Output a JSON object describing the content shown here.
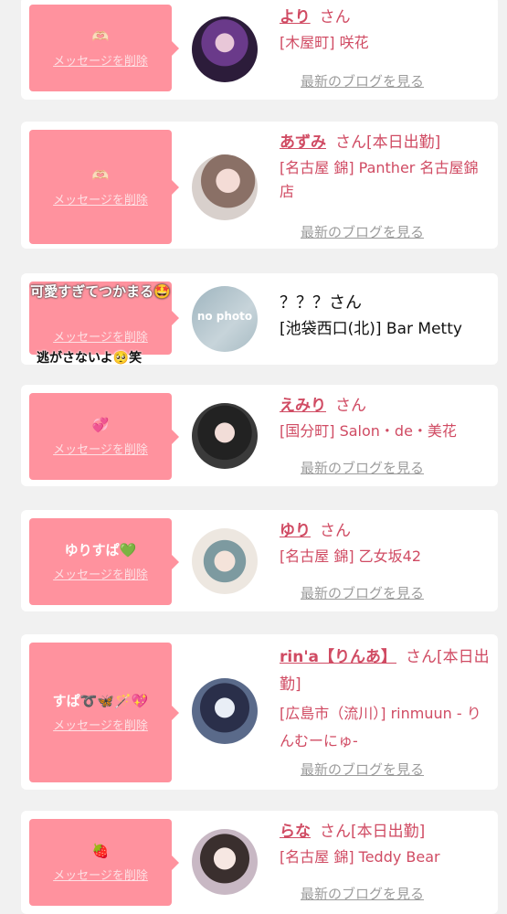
{
  "delete_label": "メッセージを削除",
  "blog_label": "最新のブログを見る",
  "cards": [
    {
      "message": "🫶🏻",
      "name": "より",
      "suffix": "さん",
      "shop": "[木屋町] 咲花",
      "avatar_icon": "user-photo-icon"
    },
    {
      "message": "🫶🏻",
      "name": "あずみ",
      "suffix": "さん[本日出勤]",
      "shop": "[名古屋 錦] Panther 名古屋錦店",
      "avatar_icon": "user-photo-icon"
    },
    {
      "message": "可愛すぎてつかまる🤩",
      "overlay": "逃がさないよ🥺笑",
      "name": "？？？",
      "suffix": "さん",
      "shop": "[池袋西口(北)] Bar Metty",
      "avatar_text": "no photo",
      "avatar_icon": "no-photo-icon"
    },
    {
      "message": "💞",
      "name": "えみり",
      "suffix": "さん",
      "shop": "[国分町] Salon・de・美花",
      "avatar_icon": "user-photo-icon"
    },
    {
      "message": "ゆりすぱ💚",
      "name": "ゆり",
      "suffix": "さん",
      "shop": "[名古屋 錦] 乙女坂42",
      "avatar_icon": "user-photo-icon"
    },
    {
      "message": "すぱ➰🦋🪄💖",
      "name": "rin'a【りんあ】",
      "suffix": "さん[本日出勤]",
      "shop": "[広島市（流川）] rinmuun - りんむーにゅ-",
      "avatar_icon": "user-photo-icon"
    },
    {
      "message": "🍓",
      "name": "らな",
      "suffix": "さん[本日出勤]",
      "shop": "[名古屋 錦] Teddy Bear",
      "avatar_icon": "user-photo-icon"
    }
  ],
  "colors": {
    "accent": "#d04b63",
    "bubble": "#ff929e",
    "background": "#f1f1f1"
  }
}
